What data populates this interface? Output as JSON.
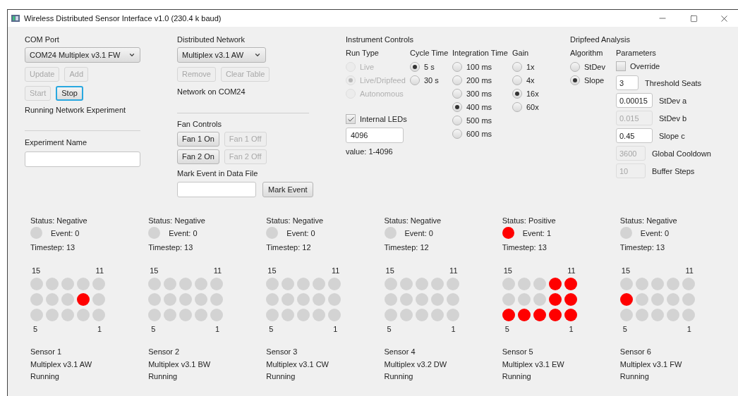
{
  "window": {
    "title": "Wireless Distributed Sensor Interface v1.0 (230.4 k baud)"
  },
  "com_port": {
    "label": "COM Port",
    "dropdown": "COM24 Multiplex v3.1 FW",
    "buttons": [
      [
        {
          "label": "Update",
          "disabled": true,
          "focused": false
        },
        {
          "label": "Add",
          "disabled": true,
          "focused": false
        }
      ],
      [
        {
          "label": "Start",
          "disabled": true,
          "focused": false
        },
        {
          "label": "Stop",
          "disabled": false,
          "focused": true
        }
      ]
    ],
    "status": "Running Network Experiment"
  },
  "experiment_name": {
    "label": "Experiment Name"
  },
  "distributed_network": {
    "label": "Distributed Network",
    "dropdown": "Multiplex v3.1 AW",
    "buttons": [
      {
        "label": "Remove",
        "disabled": true
      },
      {
        "label": "Clear Table",
        "disabled": true
      }
    ],
    "status": "Network on COM24"
  },
  "fan_controls": {
    "label": "Fan Controls",
    "buttons": [
      [
        {
          "label": "Fan 1 On",
          "disabled": false
        },
        {
          "label": "Fan 1 Off",
          "disabled": true
        }
      ],
      [
        {
          "label": "Fan 2 On",
          "disabled": false
        },
        {
          "label": "Fan 2 Off",
          "disabled": true
        }
      ]
    ]
  },
  "mark_event": {
    "label": "Mark Event in Data File",
    "button": "Mark Event"
  },
  "instrument_controls": {
    "title": "Instrument Controls",
    "groups": [
      {
        "label": "Run Type",
        "options": [
          {
            "label": "Live",
            "selected": false,
            "disabled": true
          },
          {
            "label": "Live/Dripfeed",
            "selected": true,
            "disabled": true
          },
          {
            "label": "Autonomous",
            "selected": false,
            "disabled": true
          }
        ]
      },
      {
        "label": "Cycle Time",
        "options": [
          {
            "label": "5 s",
            "selected": true,
            "disabled": false
          },
          {
            "label": "30 s",
            "selected": false,
            "disabled": false
          }
        ]
      },
      {
        "label": "Integration Time",
        "options": [
          {
            "label": "100 ms",
            "selected": false,
            "disabled": false
          },
          {
            "label": "200 ms",
            "selected": false,
            "disabled": false
          },
          {
            "label": "300 ms",
            "selected": false,
            "disabled": false
          },
          {
            "label": "400 ms",
            "selected": true,
            "disabled": false
          },
          {
            "label": "500 ms",
            "selected": false,
            "disabled": false
          },
          {
            "label": "600 ms",
            "selected": false,
            "disabled": false
          }
        ]
      },
      {
        "label": "Gain",
        "options": [
          {
            "label": "1x",
            "selected": false,
            "disabled": false
          },
          {
            "label": "4x",
            "selected": false,
            "disabled": false
          },
          {
            "label": "16x",
            "selected": true,
            "disabled": false
          },
          {
            "label": "60x",
            "selected": false,
            "disabled": false
          }
        ]
      }
    ],
    "internal_leds": {
      "label": "Internal LEDs",
      "checked": true,
      "value": "4096",
      "hint": "value: 1-4096"
    }
  },
  "dripfeed_analysis": {
    "title": "Dripfeed Analysis",
    "algorithm": {
      "label": "Algorithm",
      "options": [
        {
          "label": "StDev",
          "selected": false
        },
        {
          "label": "Slope",
          "selected": true
        }
      ]
    },
    "parameters": {
      "label": "Parameters",
      "override": {
        "label": "Override",
        "checked": false
      },
      "fields": [
        {
          "value": "3",
          "label": "Threshold Seats",
          "disabled": false
        },
        {
          "value": "0.00015",
          "label": "StDev a",
          "disabled": false
        },
        {
          "value": "0.015",
          "label": "StDev b",
          "disabled": true
        },
        {
          "value": "0.45",
          "label": "Slope c",
          "disabled": false
        },
        {
          "value": "3600",
          "label": "Global Cooldown",
          "disabled": true
        },
        {
          "value": "10",
          "label": "Buffer Steps",
          "disabled": true
        }
      ]
    }
  },
  "sensors": [
    {
      "status": "Status: Negative",
      "event_active": false,
      "event": "Event: 0",
      "timestep": "Timestep: 13",
      "corner_labels": [
        "15",
        "11",
        "5",
        "1"
      ],
      "leds": [
        [
          false,
          false,
          false,
          false,
          false
        ],
        [
          false,
          false,
          false,
          true,
          false
        ],
        [
          false,
          false,
          false,
          false,
          false
        ]
      ],
      "name": "Sensor 1",
      "model": "Multiplex v3.1 AW",
      "state": "Running"
    },
    {
      "status": "Status: Negative",
      "event_active": false,
      "event": "Event: 0",
      "timestep": "Timestep: 13",
      "corner_labels": [
        "15",
        "11",
        "5",
        "1"
      ],
      "leds": [
        [
          false,
          false,
          false,
          false,
          false
        ],
        [
          false,
          false,
          false,
          false,
          false
        ],
        [
          false,
          false,
          false,
          false,
          false
        ]
      ],
      "name": "Sensor 2",
      "model": "Multiplex v3.1 BW",
      "state": "Running"
    },
    {
      "status": "Status: Negative",
      "event_active": false,
      "event": "Event: 0",
      "timestep": "Timestep: 12",
      "corner_labels": [
        "15",
        "11",
        "5",
        "1"
      ],
      "leds": [
        [
          false,
          false,
          false,
          false,
          false
        ],
        [
          false,
          false,
          false,
          false,
          false
        ],
        [
          false,
          false,
          false,
          false,
          false
        ]
      ],
      "name": "Sensor 3",
      "model": "Multiplex v3.1 CW",
      "state": "Running"
    },
    {
      "status": "Status: Negative",
      "event_active": false,
      "event": "Event: 0",
      "timestep": "Timestep: 12",
      "corner_labels": [
        "15",
        "11",
        "5",
        "1"
      ],
      "leds": [
        [
          false,
          false,
          false,
          false,
          false
        ],
        [
          false,
          false,
          false,
          false,
          false
        ],
        [
          false,
          false,
          false,
          false,
          false
        ]
      ],
      "name": "Sensor 4",
      "model": "Multiplex v3.2 DW",
      "state": "Running"
    },
    {
      "status": "Status: Positive",
      "event_active": true,
      "event": "Event: 1",
      "timestep": "Timestep: 13",
      "corner_labels": [
        "15",
        "11",
        "5",
        "1"
      ],
      "leds": [
        [
          false,
          false,
          false,
          true,
          true
        ],
        [
          false,
          false,
          false,
          true,
          true
        ],
        [
          true,
          true,
          true,
          true,
          true
        ]
      ],
      "name": "Sensor 5",
      "model": "Multiplex v3.1 EW",
      "state": "Running"
    },
    {
      "status": "Status: Negative",
      "event_active": false,
      "event": "Event: 0",
      "timestep": "Timestep: 13",
      "corner_labels": [
        "15",
        "11",
        "5",
        "1"
      ],
      "leds": [
        [
          false,
          false,
          false,
          false,
          false
        ],
        [
          true,
          false,
          false,
          false,
          false
        ],
        [
          false,
          false,
          false,
          false,
          false
        ]
      ],
      "name": "Sensor 6",
      "model": "Multiplex v3.1 FW",
      "state": "Running"
    }
  ]
}
